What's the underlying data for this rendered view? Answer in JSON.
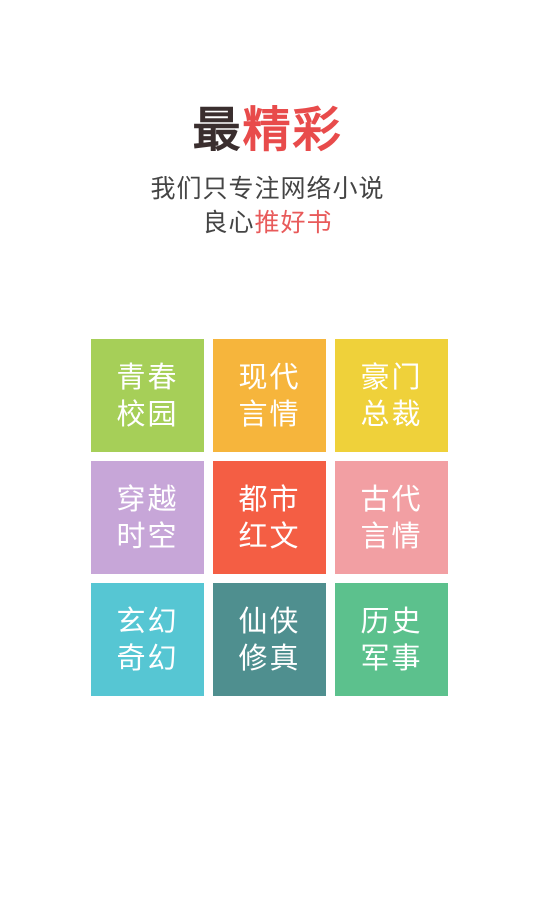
{
  "header": {
    "logo_part1": "最",
    "logo_part2": "精彩",
    "tagline_line1": "我们只专注网络小说",
    "tagline_line2_prefix": "良心",
    "tagline_line2_highlight": "推好书"
  },
  "categories": [
    {
      "line1": "青春",
      "line2": "校园",
      "color": "#a6cf58"
    },
    {
      "line1": "现代",
      "line2": "言情",
      "color": "#f6b53c"
    },
    {
      "line1": "豪门",
      "line2": "总裁",
      "color": "#efd13a"
    },
    {
      "line1": "穿越",
      "line2": "时空",
      "color": "#c7a6d8"
    },
    {
      "line1": "都市",
      "line2": "红文",
      "color": "#f45e44"
    },
    {
      "line1": "古代",
      "line2": "言情",
      "color": "#f29fa3"
    },
    {
      "line1": "玄幻",
      "line2": "奇幻",
      "color": "#56c6d3"
    },
    {
      "line1": "仙侠",
      "line2": "修真",
      "color": "#4f8f8f"
    },
    {
      "line1": "历史",
      "line2": "军事",
      "color": "#5cc18d"
    }
  ]
}
